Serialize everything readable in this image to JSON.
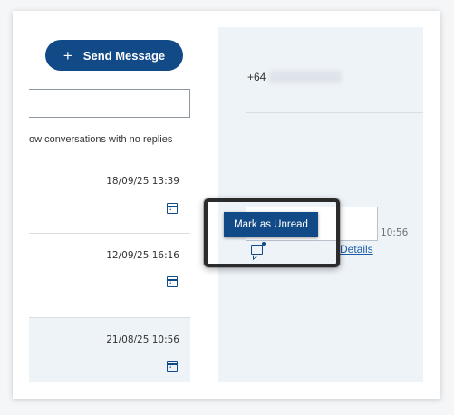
{
  "conversations_panel": {
    "send_button_label": "Send Message",
    "send_button_icon": "plus-icon",
    "search_placeholder": "",
    "filter_text": "ow conversations with no replies",
    "items": [
      {
        "timestamp": "18/09/25 13:39",
        "icon": "archive-icon"
      },
      {
        "timestamp": "12/09/25 16:16",
        "icon": "archive-icon"
      },
      {
        "timestamp": "21/08/25 10:56",
        "icon": "archive-icon"
      }
    ]
  },
  "detail_panel": {
    "phone_prefix": "+64",
    "message_time": "10:56",
    "details_link": "Details",
    "comment_icon": "comment-add-icon"
  },
  "tooltip": {
    "label": "Mark as Unread"
  },
  "colors": {
    "accent": "#124a87",
    "link": "#1a5da6",
    "panel_bg": "#eef3f8"
  }
}
